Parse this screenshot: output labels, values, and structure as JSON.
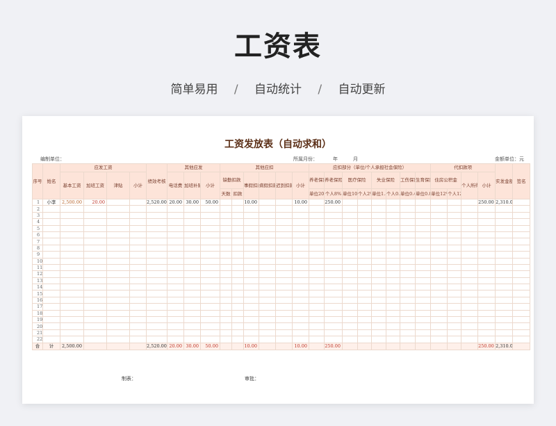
{
  "hero": {
    "title": "工资表",
    "subtitle": [
      "简单易用",
      "/",
      "自动统计",
      "/",
      "自动更新"
    ]
  },
  "sheet": {
    "title": "工资发放表（自动求和）",
    "meta_left": "编制单位：",
    "meta_mid_prefix": "所属月份：",
    "meta_year": "年",
    "meta_month": "月",
    "meta_right": "金额单位：元",
    "headers": {
      "seq": "序号",
      "name": "姓名",
      "payable": "应发工资",
      "base": "基本工资",
      "overtime": "加班工资",
      "allowance": "津贴",
      "performance": "绩效考核",
      "subtotal": "小计",
      "other_payable": "其他应发",
      "phone": "电话费",
      "overtime_subsidy": "加班补贴",
      "other_deduct": "其他应扣",
      "absence": "缺勤扣款",
      "days": "天数",
      "deduct": "扣款",
      "personal_leave": "事假扣款",
      "sick_leave": "病假扣款",
      "late": "迟到扣款",
      "insurance": "应扣部分（单位/个人承担社会保险）",
      "pension_unit": "养老保险",
      "pension_person": "养老保险",
      "medical": "医疗保险",
      "unemployment": "失业保险",
      "injury": "工伤保险",
      "maternity": "生育保险",
      "unit_20": "单位20%",
      "person_8": "个人8%",
      "unit_10": "单位10%",
      "person_2": "个人2%+3",
      "unit_15": "单位1.5%",
      "person_05": "个人0.5%",
      "unit_04": "单位0.4%",
      "unit_08": "单位0.8%",
      "withhold": "代扣款项",
      "housing": "住房公积金",
      "unit_12": "单位12%",
      "person_12": "个人12%",
      "income_tax": "个人所得税",
      "net_pay": "实发金额",
      "signature": "签名"
    },
    "row1": {
      "idx": "1",
      "name": "小李",
      "base": "2,500.00",
      "overtime": "20.00",
      "subtotal": "2,520.00",
      "phone": "20.00",
      "overtime_subsidy": "30.00",
      "other_subtotal": "50.00",
      "personal_leave": "10.00",
      "deduct_subtotal": "10.00",
      "pension_person": "250.00",
      "withhold_subtotal": "250.00",
      "net_pay": "2,310.00"
    },
    "row_numbers": [
      "2",
      "3",
      "4",
      "5",
      "6",
      "7",
      "8",
      "9",
      "10",
      "11",
      "12",
      "13",
      "14",
      "15",
      "16",
      "17",
      "18",
      "19",
      "20",
      "21",
      "22"
    ],
    "total": {
      "label_1": "合",
      "label_2": "计",
      "base": "2,500.00",
      "subtotal": "2,520.00",
      "phone": "20.00",
      "overtime_subsidy": "30.00",
      "other_subtotal": "50.00",
      "personal_leave": "10.00",
      "deduct_subtotal": "10.00",
      "pension_person": "250.00",
      "withhold_subtotal": "250.00",
      "net_pay": "2,310.00"
    },
    "footer_maker": "制表：",
    "footer_audit": "审批："
  }
}
